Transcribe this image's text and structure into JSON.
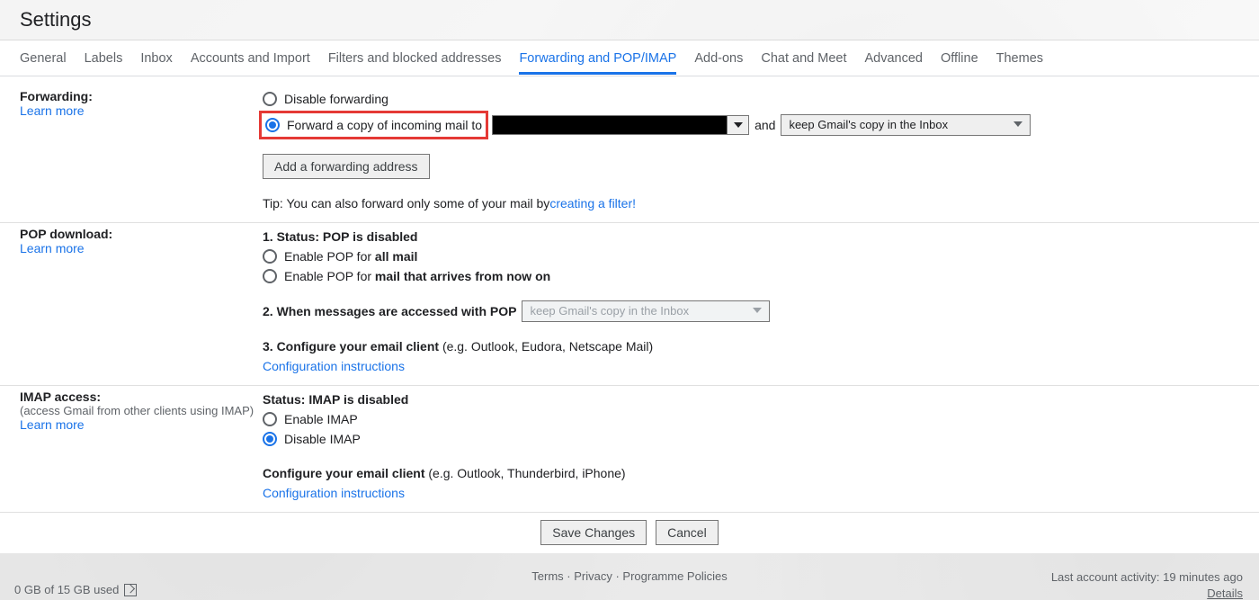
{
  "page_title": "Settings",
  "tabs": [
    "General",
    "Labels",
    "Inbox",
    "Accounts and Import",
    "Filters and blocked addresses",
    "Forwarding and POP/IMAP",
    "Add-ons",
    "Chat and Meet",
    "Advanced",
    "Offline",
    "Themes"
  ],
  "forwarding": {
    "title": "Forwarding:",
    "learn": "Learn more",
    "disable_label": "Disable forwarding",
    "forward_label": "Forward a copy of incoming mail to",
    "and": "and",
    "action_select": "keep Gmail's copy in the Inbox",
    "add_button": "Add a forwarding address",
    "tip_prefix": "Tip: You can also forward only some of your mail by ",
    "tip_link": "creating a filter!"
  },
  "pop": {
    "title": "POP download:",
    "learn": "Learn more",
    "status_line_prefix": "1. Status: ",
    "status_line_value": "POP is disabled",
    "enable_all_prefix": "Enable POP for ",
    "enable_all_bold": "all mail",
    "enable_now_prefix": "Enable POP for ",
    "enable_now_bold": "mail that arrives from now on",
    "when_prefix": "2. When messages are accessed with POP",
    "when_select": "keep Gmail's copy in the Inbox",
    "configure_prefix": "3. Configure your email client ",
    "configure_hint": "(e.g. Outlook, Eudora, Netscape Mail)",
    "config_link": "Configuration instructions"
  },
  "imap": {
    "title": "IMAP access:",
    "subtext": "(access Gmail from other clients using IMAP)",
    "learn": "Learn more",
    "status_prefix": "Status: ",
    "status_value": "IMAP is disabled",
    "enable_label": "Enable IMAP",
    "disable_label": "Disable IMAP",
    "configure_prefix": "Configure your email client ",
    "configure_hint": "(e.g. Outlook, Thunderbird, iPhone)",
    "config_link": "Configuration instructions"
  },
  "buttons": {
    "save": "Save Changes",
    "cancel": "Cancel"
  },
  "footer": {
    "storage": "0 GB of 15 GB used",
    "terms": "Terms",
    "privacy": "Privacy",
    "policies": "Programme Policies",
    "activity": "Last account activity: 19 minutes ago",
    "details": "Details"
  }
}
